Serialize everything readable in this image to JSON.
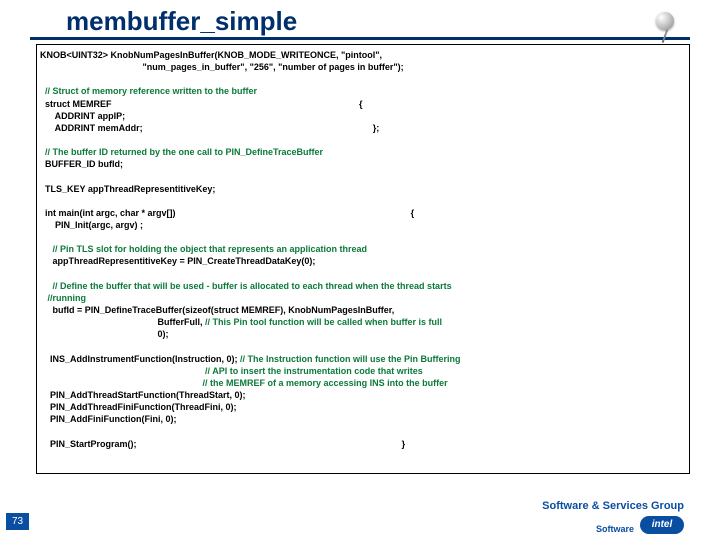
{
  "slide": {
    "title": "membuffer_simple",
    "page_number": "73",
    "footer_text": "Software & Services Group",
    "branding": {
      "logo_text": "intel",
      "tagline": "Software"
    }
  },
  "code": {
    "l1a": "KNOB<UINT32> KnobNumPagesInBuffer(KNOB_MODE_WRITEONCE, \"pintool\",",
    "l1b": "                                         \"num_pages_in_buffer\", \"256\", \"number of pages in buffer\");",
    "blank1": "",
    "c1": "  // Struct of memory reference written to the buffer",
    "l2a": "  struct MEMREF                                                                                                   {",
    "l2b": "      ADDRINT appIP;",
    "l2c": "      ADDRINT memAddr;                                                                                            };",
    "blank2": "",
    "c2": "  // The buffer ID returned by the one call to PIN_DefineTraceBuffer",
    "l3": "  BUFFER_ID bufId;",
    "blank3": "",
    "l4": "  TLS_KEY appThreadRepresentitiveKey;",
    "blank4": "",
    "l5a": "  int main(int argc, char * argv[])                                                                                              {",
    "l5b": "      PIN_Init(argc, argv) ;",
    "blank5": "",
    "c3": "     // Pin TLS slot for holding the object that represents an application thread",
    "l6": "     appThreadRepresentitiveKey = PIN_CreateThreadDataKey(0);",
    "blank6": "",
    "c4": "     // Define the buffer that will be used - buffer is allocated to each thread when the thread starts",
    "c4b": "   //running",
    "l7a": "     bufId = PIN_DefineTraceBuffer(sizeof(struct MEMREF), KnobNumPagesInBuffer,",
    "l7b_pre": "                                               BufferFull, ",
    "c5": "// This Pin tool function will be called when buffer is full",
    "l7c": "                                               0);",
    "blank7": "",
    "l8a_pre": "    INS_AddInstrumentFunction(Instruction, 0); ",
    "c6a": "// The Instruction function will use the Pin Buffering",
    "c6b": "                                                                  // API to insert the instrumentation code that writes",
    "c6c": "                                                                 // the MEMREF of a memory accessing INS into the buffer",
    "l9": "    PIN_AddThreadStartFunction(ThreadStart, 0);",
    "l10": "    PIN_AddThreadFiniFunction(ThreadFini, 0);",
    "l11": "    PIN_AddFiniFunction(Fini, 0);",
    "blank8": "",
    "l12": "    PIN_StartProgram();                                                                                                          }"
  }
}
